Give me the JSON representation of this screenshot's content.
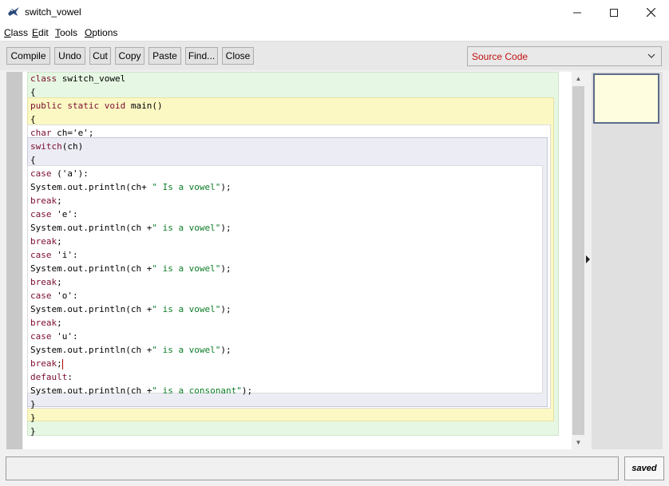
{
  "window": {
    "title": "switch_vowel"
  },
  "menu": [
    "Class",
    "Edit",
    "Tools",
    "Options"
  ],
  "toolbar": {
    "compile": "Compile",
    "undo": "Undo",
    "cut": "Cut",
    "copy": "Copy",
    "paste": "Paste",
    "find": "Find...",
    "close": "Close"
  },
  "view_select": {
    "value": "Source Code"
  },
  "code": [
    "class switch_vowel",
    "{",
    "public static void main()",
    "{",
    "char ch='e';",
    "switch(ch)",
    "{",
    "case ('a'):",
    "System.out.println(ch+ \" Is a vowel\");",
    "break;",
    "case 'e':",
    "System.out.println(ch +\" is a vowel\");",
    "break;",
    "case 'i':",
    "System.out.println(ch +\" is a vowel\");",
    "break;",
    "case 'o':",
    "System.out.println(ch +\" is a vowel\");",
    "break;",
    "case 'u':",
    "System.out.println(ch +\" is a vowel\");",
    "break;",
    "default:",
    "System.out.println(ch +\" is a consonant\");",
    "}",
    "}",
    "}"
  ],
  "status": {
    "message": "",
    "saved": "saved"
  },
  "icons": {
    "app": "bluej-bird-icon",
    "minimize": "minimize-icon",
    "maximize": "maximize-icon",
    "close": "close-icon",
    "dropdown": "chevron-down-icon"
  }
}
